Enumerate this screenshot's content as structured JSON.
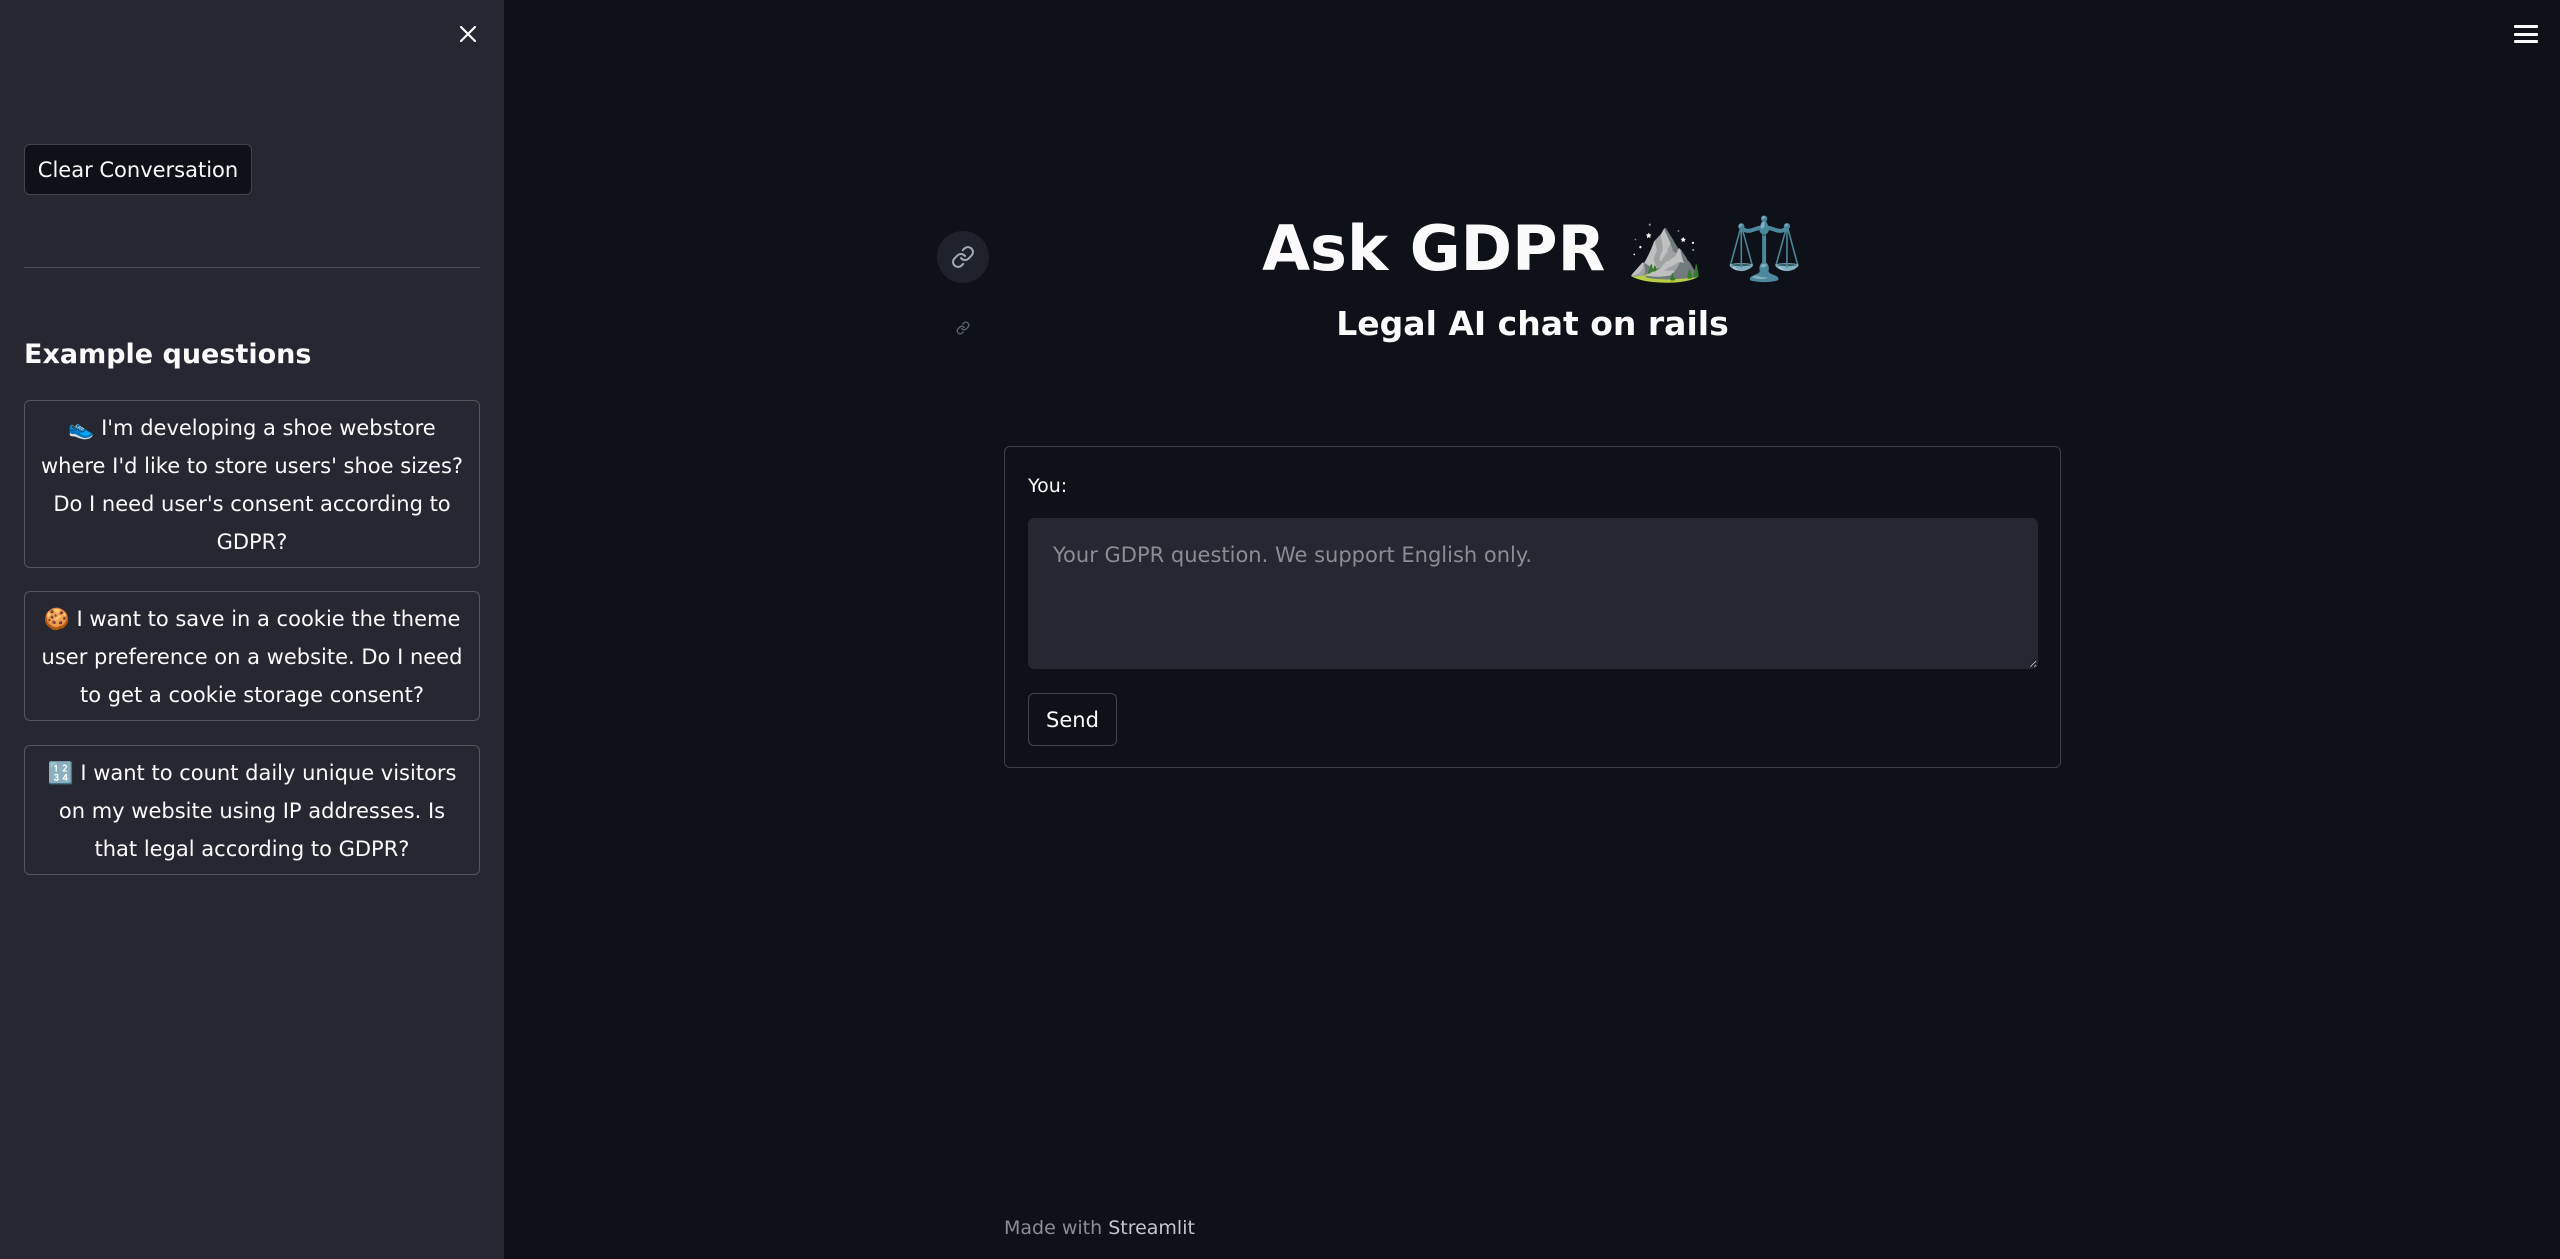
{
  "sidebar": {
    "clear_button": "Clear Conversation",
    "examples_title": "Example questions",
    "examples": [
      {
        "icon": "👟",
        "text": "I'm developing a shoe webstore where I'd like to store users' shoe sizes? Do I need user's consent according to GDPR?"
      },
      {
        "icon": "🍪",
        "text": "I want to save in a cookie the theme user preference on a website. Do I need to get a cookie storage consent?"
      },
      {
        "icon": "🔢",
        "text": "I want to count daily unique visitors on my website using IP addresses. Is that legal according to GDPR?"
      }
    ]
  },
  "main": {
    "title": "Ask GDPR",
    "title_emoji": "⛰️ ⚖️",
    "subtitle": "Legal AI chat on rails",
    "input_label": "You:",
    "input_placeholder": "Your GDPR question. We support English only.",
    "input_value": "",
    "send_button": "Send"
  },
  "footer": {
    "prefix": "Made with",
    "brand": "Streamlit"
  },
  "colors": {
    "main_background": "#0e1117",
    "sidebar_background": "#262730",
    "text": "#fafafa"
  }
}
